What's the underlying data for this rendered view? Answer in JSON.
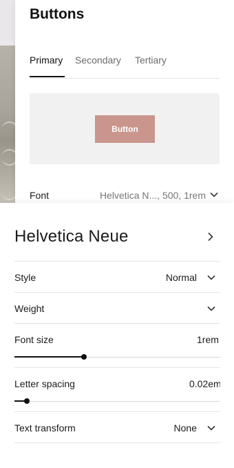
{
  "panel": {
    "title": "Buttons",
    "tabs": [
      {
        "label": "Primary",
        "active": true
      },
      {
        "label": "Secondary",
        "active": false
      },
      {
        "label": "Tertiary",
        "active": false
      }
    ],
    "preview_button_label": "Button",
    "preview_button_color": "#c9958c",
    "font_row": {
      "label": "Font",
      "value": "Helvetica N..., 500, 1rem"
    }
  },
  "font_panel": {
    "font_name": "Helvetica Neue",
    "style": {
      "label": "Style",
      "value": "Normal"
    },
    "weight": {
      "label": "Weight",
      "value": ""
    },
    "font_size": {
      "label": "Font size",
      "value": "1rem",
      "slider_fraction": 0.34
    },
    "letter_spacing": {
      "label": "Letter spacing",
      "value": "0.02em",
      "slider_fraction": 0.06
    },
    "text_transform": {
      "label": "Text transform",
      "value": "None"
    }
  }
}
